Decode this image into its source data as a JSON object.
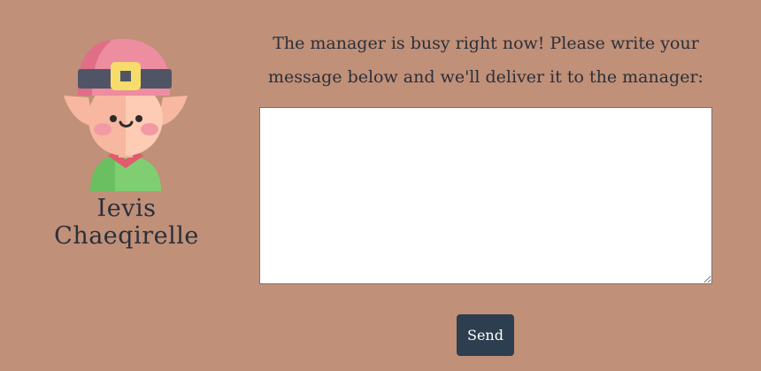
{
  "elf": {
    "name": "Ievis Chaeqirelle",
    "avatar_icon": "elf-avatar-icon"
  },
  "message": {
    "prompt": "The manager is busy right now! Please write your message below and we'll deliver it to the manager:",
    "value": "",
    "placeholder": ""
  },
  "actions": {
    "send_label": "Send"
  },
  "colors": {
    "background": "#c09078",
    "button": "#2d3e50",
    "text": "#2b2f3b"
  }
}
